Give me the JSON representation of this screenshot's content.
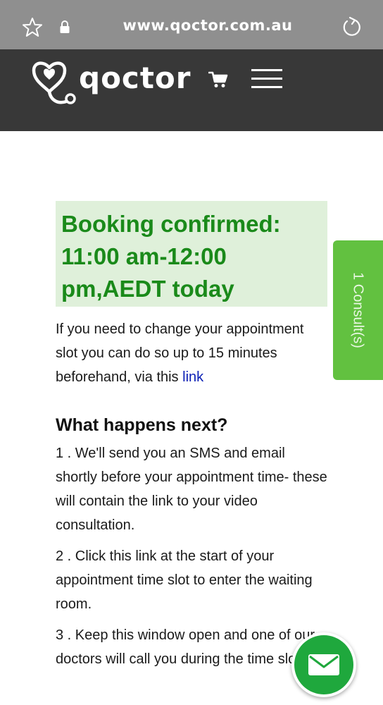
{
  "browser": {
    "url": "www.qoctor.com.au",
    "icons": [
      "star-icon",
      "lock-icon",
      "reload-icon"
    ]
  },
  "header": {
    "logo_text": "qoctor",
    "icons": [
      "stethoscope-heart-icon",
      "cart-icon",
      "hamburger-menu-icon"
    ]
  },
  "banner": {
    "title": "Booking confirmed: 11:00 am-12:00 pm,AEDT today"
  },
  "intro": {
    "text": "If you need to change your appointment slot you can do so up to 15 minutes beforehand, via this ",
    "link_label": "link"
  },
  "next": {
    "title": "What happens next?",
    "steps": [
      "1 . We'll send you an SMS and email shortly before your appointment time- these will contain the link to your video consultation.",
      "2 . Click this link at the start of your appointment time slot to enter the waiting room.",
      "3 . Keep this window open and one of our doctors will call you during the time slot."
    ]
  },
  "side_tab": {
    "label": "1 Consult(s)"
  },
  "colors": {
    "header_bg": "#383838",
    "banner_bg": "#dff0da",
    "banner_text": "#1a8a1a",
    "tab_green": "#62c140",
    "fab_green": "#1fa83d",
    "link": "#0a1fb5"
  }
}
